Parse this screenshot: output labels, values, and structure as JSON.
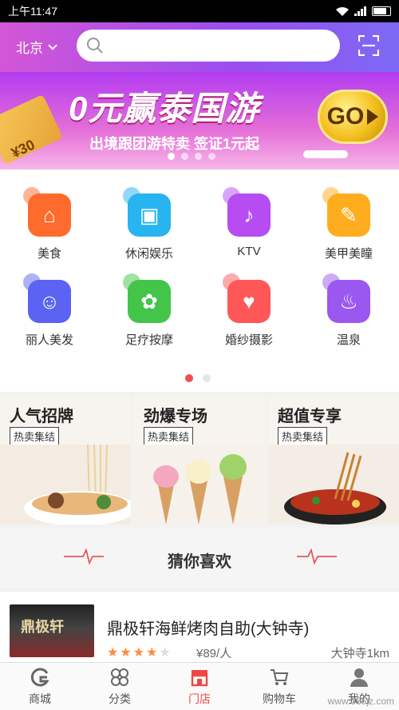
{
  "status": {
    "time": "上午11:47"
  },
  "header": {
    "city": "北京",
    "search_placeholder": ""
  },
  "banner": {
    "title": "0元赢泰国游",
    "subtitle": "出境跟团游特卖 签证1元起",
    "cta": "GO",
    "ticket_text": "¥30",
    "slides": 4,
    "active_slide": 0
  },
  "categories": [
    {
      "label": "美食",
      "icon": "cloche-icon",
      "color": "#ff6b2c",
      "glyph": "⌂"
    },
    {
      "label": "休闲娱乐",
      "icon": "gamepad-icon",
      "color": "#27b4f0",
      "glyph": "▣"
    },
    {
      "label": "KTV",
      "icon": "microphone-icon",
      "color": "#b64cf2",
      "glyph": "♪"
    },
    {
      "label": "美甲美瞳",
      "icon": "nail-brush-icon",
      "color": "#ffad1f",
      "glyph": "✎"
    },
    {
      "label": "丽人美发",
      "icon": "hair-icon",
      "color": "#5a63f2",
      "glyph": "☺"
    },
    {
      "label": "足疗按摩",
      "icon": "foot-icon",
      "color": "#43c54a",
      "glyph": "✿"
    },
    {
      "label": "婚纱摄影",
      "icon": "couple-icon",
      "color": "#ff5757",
      "glyph": "♥"
    },
    {
      "label": "温泉",
      "icon": "hot-spring-icon",
      "color": "#9b58f0",
      "glyph": "♨"
    }
  ],
  "category_pages": 2,
  "promos": [
    {
      "title": "人气招牌",
      "tag": "热卖集结"
    },
    {
      "title": "劲爆专场",
      "tag": "热卖集结"
    },
    {
      "title": "超值专享",
      "tag": "热卖集结"
    }
  ],
  "recommend": {
    "title": "猜你喜欢"
  },
  "item": {
    "title": "鼎极轩海鲜烤肉自助(大钟寺)",
    "rating": 4,
    "rating_max": 5,
    "price": "¥89/人",
    "distance": "大钟寺1km",
    "thumb_sign": "鼎极轩"
  },
  "tabs": [
    {
      "label": "商城",
      "icon": "mall-icon"
    },
    {
      "label": "分类",
      "icon": "category-icon"
    },
    {
      "label": "门店",
      "icon": "store-icon",
      "active": true
    },
    {
      "label": "购物车",
      "icon": "cart-icon"
    },
    {
      "label": "我的",
      "icon": "user-icon"
    }
  ],
  "watermark": "www.365jz.com",
  "colors": {
    "accent": "#f04545",
    "rating": "#ff8a3d"
  }
}
